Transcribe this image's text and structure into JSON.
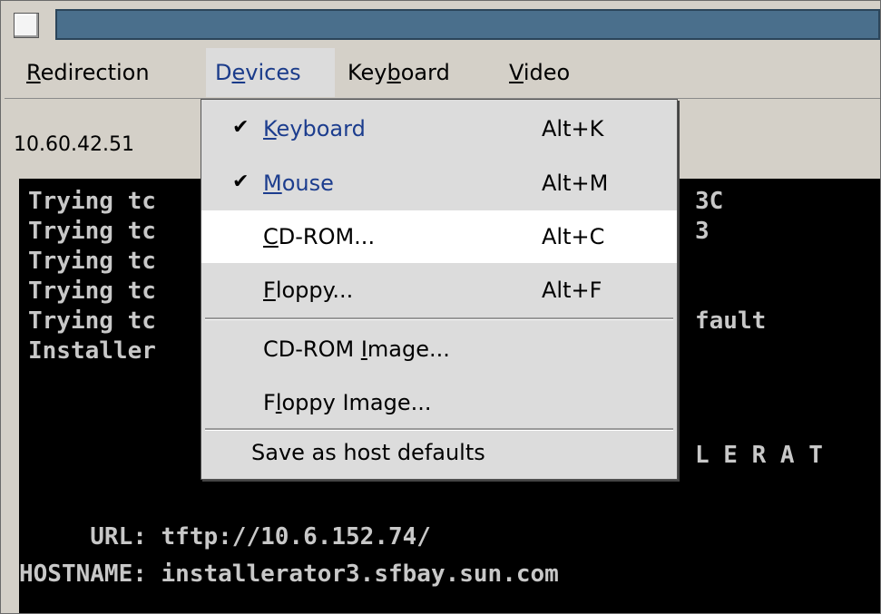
{
  "menubar": {
    "redirection": {
      "pre": "",
      "u": "R",
      "post": "edirection"
    },
    "devices": {
      "pre": "D",
      "u": "e",
      "post": "vices"
    },
    "keyboard": {
      "pre": "Key",
      "u": "b",
      "post": "oard"
    },
    "video": {
      "pre": "",
      "u": "V",
      "post": "ideo"
    }
  },
  "toolbar": {
    "ip": "10.60.42.51"
  },
  "console": {
    "lines": [
      "Trying tc",
      "Trying tc",
      "Trying tc",
      "Trying tc",
      "Trying tc",
      "Installer"
    ],
    "right_fragments": [
      "3C",
      "3",
      "",
      "",
      "fault",
      ""
    ],
    "banner": "L E R A T",
    "url_line": "     URL: tftp://10.6.152.74/",
    "host_line": "HOSTNAME: installerator3.sfbay.sun.com"
  },
  "dropdown": {
    "keyboard": {
      "check": "✔",
      "u": "K",
      "post": "eyboard",
      "accel": "Alt+K"
    },
    "mouse": {
      "check": "✔",
      "u": "M",
      "post": "ouse",
      "accel": "Alt+M"
    },
    "cdrom": {
      "u": "C",
      "post": "D-ROM...",
      "accel": "Alt+C"
    },
    "floppy": {
      "u": "F",
      "post": "loppy...",
      "accel": "Alt+F"
    },
    "cdrom_image": {
      "pre": "CD-ROM ",
      "u": "I",
      "post": "mage..."
    },
    "floppy_image": {
      "pre": "F",
      "u": "l",
      "post": "oppy Image..."
    },
    "save": "Save as host defaults"
  }
}
